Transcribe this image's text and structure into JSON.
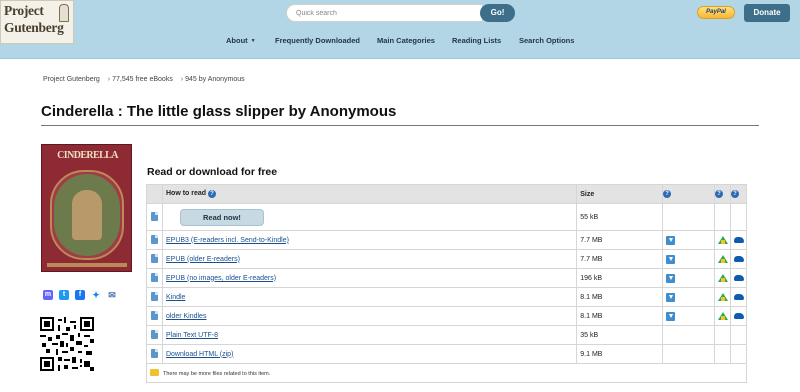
{
  "header": {
    "logo_line1": "Project",
    "logo_line2": "Gutenberg",
    "search_placeholder": "Quick search",
    "search_button": "Go!",
    "paypal_label": "PayPal",
    "donate_label": "Donate",
    "nav": [
      {
        "label": "About"
      },
      {
        "label": "Frequently Downloaded"
      },
      {
        "label": "Main Categories"
      },
      {
        "label": "Reading Lists"
      },
      {
        "label": "Search Options"
      }
    ]
  },
  "breadcrumb": [
    "Project Gutenberg",
    "77,545 free eBooks",
    "945 by Anonymous"
  ],
  "page_title": "Cinderella : The little glass slipper by Anonymous",
  "cover_text": "CINDERELLA",
  "share_icons": [
    "mastodon-icon",
    "twitter-icon",
    "facebook-icon",
    "bluesky-icon",
    "email-icon"
  ],
  "downloads": {
    "heading": "Read or download for free",
    "col_how": "How to read",
    "col_size": "Size",
    "help_glyph": "?",
    "read_now": "Read now!",
    "read_now_size": "55 kB",
    "rows": [
      {
        "label": "EPUB3 (E-readers incl. Send-to-Kindle)",
        "size": "7.7 MB"
      },
      {
        "label": "EPUB (older E-readers)",
        "size": "7.7 MB"
      },
      {
        "label": "EPUB (no images, older E-readers)",
        "size": "196 kB"
      },
      {
        "label": "Kindle",
        "size": "8.1 MB"
      },
      {
        "label": "older Kindles",
        "size": "8.1 MB"
      },
      {
        "label": "Plain Text UTF-8",
        "size": "35 kB"
      },
      {
        "label": "Download HTML (zip)",
        "size": "9.1 MB"
      }
    ],
    "note": "There may be more files related to this item."
  },
  "colors": {
    "header_bg": "#b2d6e6",
    "button_blue": "#3d6f8a",
    "link": "#1b4f8f"
  }
}
